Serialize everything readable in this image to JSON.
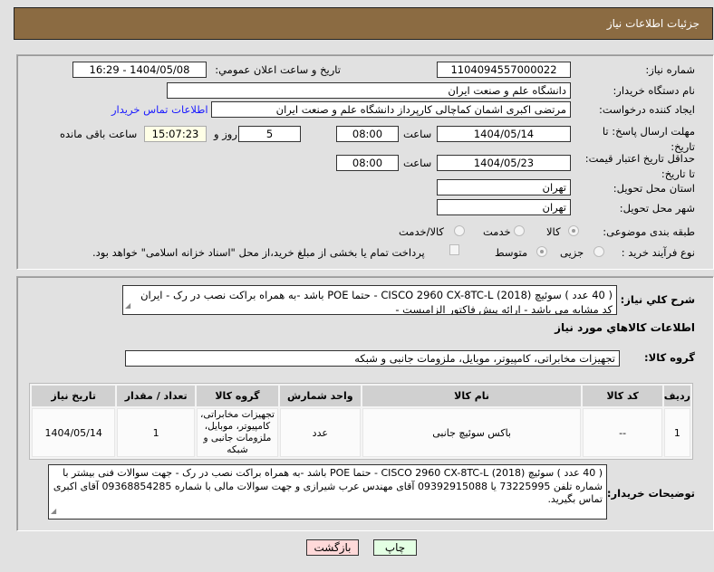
{
  "header": {
    "title": "جزئیات اطلاعات نیاز"
  },
  "form": {
    "need_number_label": "شماره نیاز:",
    "need_number": "1104094557000022",
    "announce_label": "تاریخ و ساعت اعلان عمومي:",
    "announce_value": "1404/05/08 - 16:29",
    "buyer_org_label": "نام دستگاه خريدار:",
    "buyer_org": "دانشگاه علم و صنعت ایران",
    "creator_label": "ایجاد کننده درخواست:",
    "creator": "مرتضی اکبری اشمان کماچالی کارپرداز دانشگاه علم و صنعت ایران",
    "contact_link": "اطلاعات تماس خریدار",
    "deadline_label": "مهلت ارسال پاسخ: تا تاریخ:",
    "deadline_date": "1404/05/14",
    "time_label": "ساعت",
    "deadline_time": "08:00",
    "days": "5",
    "days_label": "روز و",
    "remaining": "15:07:23",
    "remaining_label": "ساعت باقی مانده",
    "validity_label": "حداقل تاریخ اعتبار قیمت: تا تاریخ:",
    "validity_date": "1404/05/23",
    "validity_time": "08:00",
    "province_label": "استان محل تحویل:",
    "province": "تهران",
    "city_label": "شهر محل تحویل:",
    "city": "تهران",
    "category_label": "طبقه بندی موضوعی:",
    "category_options": [
      "کالا",
      "خدمت",
      "کالا/خدمت"
    ],
    "process_label": "نوع فرآیند خرید :",
    "process_options": [
      "جزیی",
      "متوسط"
    ],
    "treasury_note": "پرداخت تمام یا بخشی از مبلغ خرید،از محل \"اسناد خزانه اسلامی\" خواهد بود."
  },
  "details": {
    "desc_label": "شرح کلي نياز:",
    "desc": "( 40 عدد ) سوئیچ  (2018) CISCO 2960 CX-8TC-L - حتما  POE باشد -به همراه براکت نصب در رک -  ایران کد مشابه می باشد - ارائه پیش فاکتور الزامیست -",
    "goods_title": "اطلاعات کالاهاي مورد نياز",
    "group_label": "گروه کالا:",
    "group": "تجهیزات مخابراتی، کامپیوتر، موبایل، ملزومات جانبی و شبکه",
    "table": {
      "headers": [
        "رديف",
        "کد کالا",
        "نام کالا",
        "واحد شمارش",
        "گروه کالا",
        "تعداد / مقدار",
        "تاریخ نیاز"
      ],
      "rows": [
        [
          "1",
          "--",
          "باکس سوئیچ جانبی",
          "عدد",
          "تجهیزات مخابراتی، کامپیوتر، موبایل، ملزومات جانبی و شبکه",
          "1",
          "1404/05/14"
        ]
      ]
    },
    "notes_label": "توضیحات خریدار:",
    "notes": "( 40 عدد ) سوئیچ  (2018) CISCO 2960 CX-8TC-L - حتما  POE باشد -به همراه براکت نصب در رک - جهت سوالات فنی بیشتر با شماره تلفن 73225995 یا 09392915088 آقای مهندس عرب شیرازی و جهت سوالات مالی با شماره 09368854285 آقای اکبری تماس بگیرید."
  },
  "buttons": {
    "back": "بازگشت",
    "print": "چاپ"
  }
}
